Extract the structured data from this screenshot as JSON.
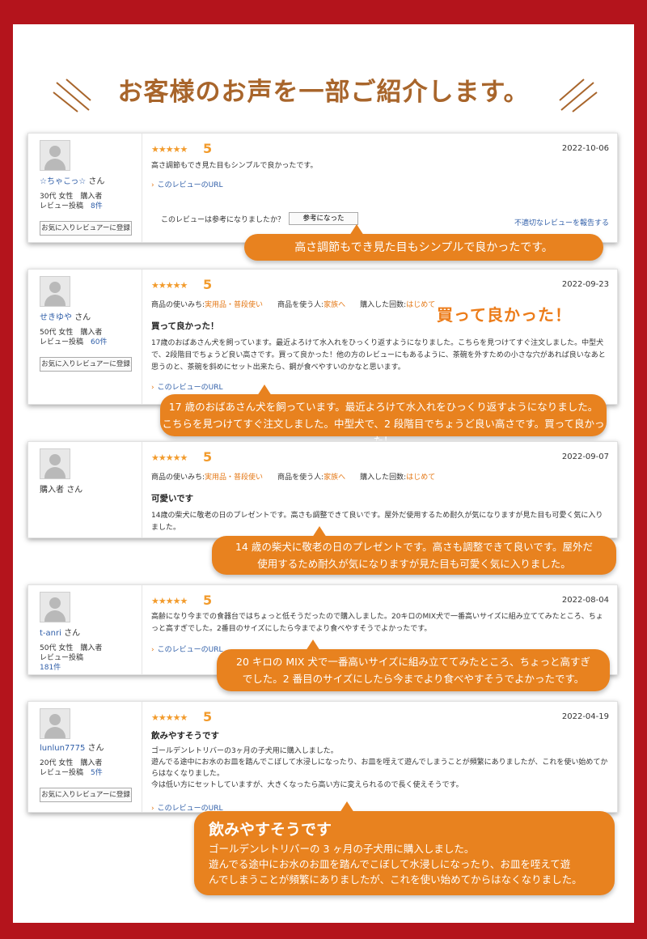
{
  "heading": "お客様のお声を一部ご紹介します。",
  "common": {
    "suffix_san": "さん",
    "buyer": "購入者",
    "review_count_label": "レビュー投稿",
    "favorite_btn": "お気に入りレビュアーに登録",
    "url_text": "このレビューのURL",
    "helpful_q": "このレビューは参考になりましたか？",
    "helpful_btn": "参考になった",
    "report": "不適切なレビューを報告する",
    "attr_usage_label": "商品の使いみち:",
    "attr_user_label": "商品を使う人:",
    "attr_times_label": "購入した回数:"
  },
  "reviews": [
    {
      "name": "☆ちゃこっ☆",
      "age_gender": "30代 女性",
      "count": "8件",
      "stars": "★★★★★",
      "score": "5",
      "date": "2022-10-06",
      "body": "高さ調節もでき見た目もシンプルで良かったです。",
      "bubble": "高さ調節もでき見た目もシンプルで良かったです。"
    },
    {
      "name": "せきゆや",
      "age_gender": "50代 女性",
      "count": "60件",
      "stars": "★★★★★",
      "score": "5",
      "date": "2022-09-23",
      "usage": "実用品・普段使い",
      "user": "家族へ",
      "times": "はじめて",
      "title": "買って良かった！",
      "body": "17歳のおばあさん犬を飼っています。最近よろけて水入れをひっくり返すようになりました。こちらを見つけてすぐ注文しました。中型犬で、2段階目でちょうど良い高さです。買って良かった！他の方のレビューにもあるように、茶碗を外すための小さな穴があれば良いなあと思うのと、茶碗を斜めにセット出来たら、鋼が食べやすいのかなと思います。",
      "highlight": "買って良かった！",
      "bubble_lines": [
        "17 歳のおばあさん犬を飼っています。最近よろけて水入れをひっくり返すようになりました。",
        "こちらを見つけてすぐ注文しました。中型犬で、2 段階目でちょうど良い高さです。買って良かった！"
      ]
    },
    {
      "name": "購入者",
      "stars": "★★★★★",
      "score": "5",
      "date": "2022-09-07",
      "usage": "実用品・普段使い",
      "user": "家族へ",
      "times": "はじめて",
      "title": "可愛いです",
      "body": "14歳の柴犬に敬老の日のプレゼントです。高さも調整できて良いです。屋外だ使用するため耐久が気になりますが見た目も可愛く気に入りました。",
      "bubble_lines": [
        "14 歳の柴犬に敬老の日のプレゼントです。高さも調整できて良いです。屋外だ",
        "使用するため耐久が気になりますが見た目も可愛く気に入りました。"
      ]
    },
    {
      "name": "t-anri",
      "age_gender": "50代 女性",
      "count": "181件",
      "stars": "★★★★★",
      "score": "5",
      "date": "2022-08-04",
      "body": "高齢になり今までの食器台ではちょっと低そうだったので購入しました。20キロのMIX犬で一番高いサイズに組み立ててみたところ、ちょっと高すぎでした。2番目のサイズにしたら今までより食べやすそうでよかったです。",
      "bubble_lines": [
        "20 キロの MIX 犬で一番高いサイズに組み立ててみたところ、ちょっと高すぎ",
        "でした。2 番目のサイズにしたら今までより食べやすそうでよかったです。"
      ]
    },
    {
      "name": "lunlun7775",
      "age_gender": "20代 女性",
      "count": "5件",
      "stars": "★★★★★",
      "score": "5",
      "date": "2022-04-19",
      "title": "飲みやすそうです",
      "body_lines": [
        "ゴールデンレトリバーの3ヶ月の子犬用に購入しました。",
        "遊んでる途中にお水のお皿を踏んでこぼして水浸しになったり、お皿を咥えて遊んでしまうことが頻繁にありましたが、これを使い始めてからはなくなりました。",
        "今は低い方にセットしていますが、大きくなったら高い方に変えられるので長く使えそうです。"
      ],
      "bubble_title": "飲みやすそうです",
      "bubble_lines": [
        "ゴールデンレトリバーの 3 ヶ月の子犬用に購入しました。",
        "遊んでる途中にお水のお皿を踏んでこぼして水浸しになったり、お皿を咥えて遊",
        "んでしまうことが頻繁にありましたが、これを使い始めてからはなくなりました。"
      ]
    }
  ]
}
